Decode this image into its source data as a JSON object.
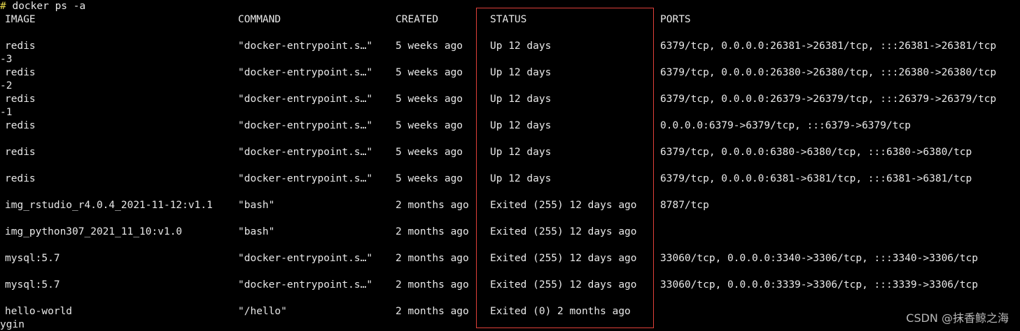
{
  "terminal": {
    "prompt": "#",
    "command": " docker ps -a",
    "headers": {
      "image": "IMAGE",
      "command": "COMMAND",
      "created": "CREATED",
      "status": "STATUS",
      "ports": "PORTS"
    },
    "rows": [
      {
        "image": "redis",
        "command": "\"docker-entrypoint.s…\"",
        "created": "5 weeks ago",
        "status": "Up 12 days",
        "ports": "6379/tcp, 0.0.0.0:26381->26381/tcp, :::26381->26381/tcp",
        "wrap": "-3"
      },
      {
        "image": "redis",
        "command": "\"docker-entrypoint.s…\"",
        "created": "5 weeks ago",
        "status": "Up 12 days",
        "ports": "6379/tcp, 0.0.0.0:26380->26380/tcp, :::26380->26380/tcp",
        "wrap": "-2"
      },
      {
        "image": "redis",
        "command": "\"docker-entrypoint.s…\"",
        "created": "5 weeks ago",
        "status": "Up 12 days",
        "ports": "6379/tcp, 0.0.0.0:26379->26379/tcp, :::26379->26379/tcp",
        "wrap": "-1"
      },
      {
        "image": "redis",
        "command": "\"docker-entrypoint.s…\"",
        "created": "5 weeks ago",
        "status": "Up 12 days",
        "ports": "0.0.0.0:6379->6379/tcp, :::6379->6379/tcp",
        "wrap": ""
      },
      {
        "image": "redis",
        "command": "\"docker-entrypoint.s…\"",
        "created": "5 weeks ago",
        "status": "Up 12 days",
        "ports": "6379/tcp, 0.0.0.0:6380->6380/tcp, :::6380->6380/tcp",
        "wrap": ""
      },
      {
        "image": "redis",
        "command": "\"docker-entrypoint.s…\"",
        "created": "5 weeks ago",
        "status": "Up 12 days",
        "ports": "6379/tcp, 0.0.0.0:6381->6381/tcp, :::6381->6381/tcp",
        "wrap": ""
      },
      {
        "image": "img_rstudio_r4.0.4_2021-11-12:v1.1",
        "command": "\"bash\"",
        "created": "2 months ago",
        "status": "Exited (255) 12 days ago",
        "ports": "8787/tcp",
        "wrap": ""
      },
      {
        "image": "img_python307_2021_11_10:v1.0",
        "command": "\"bash\"",
        "created": "2 months ago",
        "status": "Exited (255) 12 days ago",
        "ports": "",
        "wrap": ""
      },
      {
        "image": "mysql:5.7",
        "command": "\"docker-entrypoint.s…\"",
        "created": "2 months ago",
        "status": "Exited (255) 12 days ago",
        "ports": "33060/tcp, 0.0.0.0:3340->3306/tcp, :::3340->3306/tcp",
        "wrap": ""
      },
      {
        "image": "mysql:5.7",
        "command": "\"docker-entrypoint.s…\"",
        "created": "2 months ago",
        "status": "Exited (255) 12 days ago",
        "ports": "33060/tcp, 0.0.0.0:3339->3306/tcp, :::3339->3306/tcp",
        "wrap": ""
      },
      {
        "image": "hello-world",
        "command": "\"/hello\"",
        "created": "2 months ago",
        "status": "Exited (0) 2 months ago",
        "ports": "",
        "wrap": "ygin"
      }
    ]
  },
  "watermark": "CSDN @抹香鲸之海",
  "colors": {
    "background": "#000000",
    "text": "#e8e8e8",
    "prompt": "#e6d84a",
    "highlight_box": "#e0403a"
  }
}
